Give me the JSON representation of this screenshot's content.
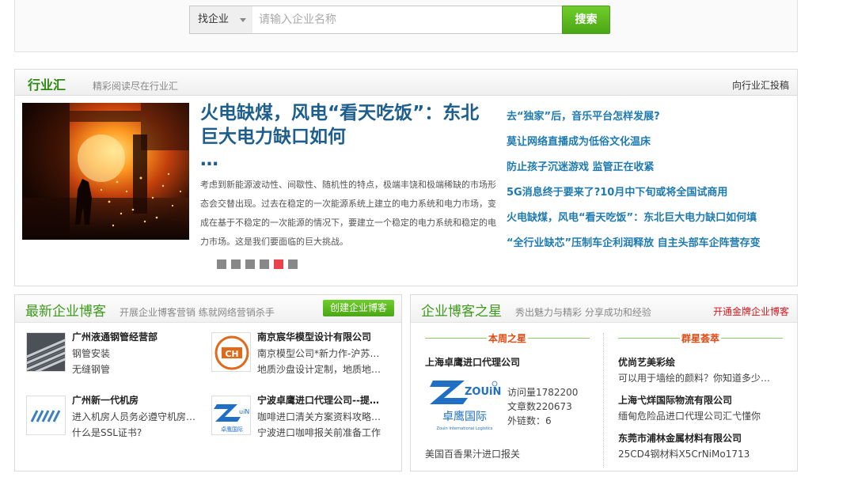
{
  "search": {
    "select_value": "找企业",
    "placeholder": "请输入企业名称",
    "button_label": "搜索"
  },
  "industry": {
    "title": "行业汇",
    "subtitle": "精彩阅读尽在行业汇",
    "submit_link": "向行业汇投稿",
    "hero": {
      "title": "火电缺煤，风电“看天吃饭”：东北巨大电力缺口如何",
      "ellipsis": "…",
      "description": "考虑到新能源波动性、间歇性、随机性的特点，极端丰饶和极端稀缺的市场形态会交替出现。过去在稳定的一次能源系统上建立的电力系统和电力市场，变成在基于不稳定的一次能源的情况下，要建立一个稳定的电力系统和稳定的电力市场。这是我们要面临的巨大挑战。"
    },
    "slides": {
      "count": 6,
      "active_index": 4
    },
    "links": [
      "去“独家”后，音乐平台怎样发展?",
      "莫让网络直播成为低俗文化温床",
      "防止孩子沉迷游戏 监管正在收紧",
      "5G消息终于要来了?10月中下旬或将全国试商用",
      "火电缺煤，风电“看天吃饭”：东北巨大电力缺口如何填",
      "“全行业缺芯”压制车企利润释放 自主头部车企阵营存变"
    ]
  },
  "blog_latest": {
    "title": "最新企业博客",
    "subtitle": "开展企业博客营销 练就网络营销杀手",
    "create_button": "创建企业博客",
    "items": [
      {
        "name": "广州液通钢管经营部",
        "lines": [
          "钢管安装",
          "无缝钢管"
        ],
        "logo_icon": "steel-pipes-image"
      },
      {
        "name": "南京宸华模型设计有限公司",
        "lines": [
          "南京模型公司*新力作-沪苏…",
          "地质沙盘设计定制，地质地…"
        ],
        "logo_icon": "ch-logo"
      },
      {
        "name": "广州新一代机房",
        "lines": [
          "进入机房人员务必遵守机房…",
          "什么是SSL证书?"
        ],
        "logo_icon": "stripes-logo"
      },
      {
        "name": "宁波卓鹰进口代理公司--提…",
        "lines": [
          "咖啡进口清关方案资料攻略…",
          "宁波进口咖啡报关前准备工作"
        ],
        "logo_icon": "zouin-logo"
      }
    ]
  },
  "blog_stars": {
    "title": "企业博客之星",
    "subtitle": "秀出魅力与精彩 分享成功和经验",
    "gold_link": "开通金牌企业博客",
    "weekly": {
      "heading": "本周之星",
      "company": "上海卓鹰进口代理公司",
      "logo_text_main": "ZOUiN",
      "logo_text_cn": "卓鹰国际",
      "logo_text_en": "Zouin International Logistics",
      "stats": [
        "访问量1782200",
        "文章数220673",
        "外链数：6"
      ],
      "footer": "美国百香果汁进口报关"
    },
    "group": {
      "heading": "群星荟萃",
      "items": [
        {
          "name": "优尚艺美彩绘",
          "line": "可以用于墙绘的颜料？你知道多少…"
        },
        {
          "name": "上海弋烊国际物流有限公司",
          "line": "缅甸危险品进口代理公司汇弋懂你"
        },
        {
          "name": "东莞市浦林金属材料有限公司",
          "line": "25CD4钢材料X5CrNiMo1713"
        }
      ]
    }
  },
  "colors": {
    "green": "#3d9a1c",
    "link_blue": "#1e7ab0",
    "title_blue": "#1d5e8c",
    "red": "#d6171c",
    "orange": "#e24a12"
  }
}
